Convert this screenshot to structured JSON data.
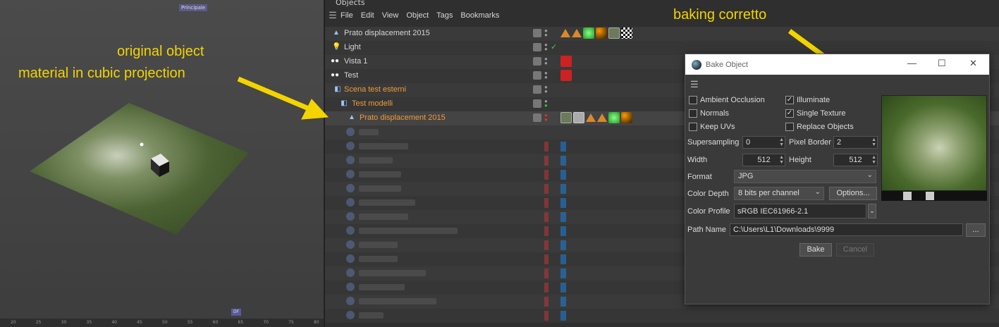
{
  "viewport": {
    "camera_label": "Principale",
    "ruler_ticks": [
      "20",
      "25",
      "30",
      "35",
      "40",
      "45",
      "50",
      "55",
      "60",
      "65",
      "70",
      "75",
      "80"
    ],
    "bottom_badge": "DF"
  },
  "annotations": {
    "left_line1": "original object",
    "left_line2": "material in cubic projection",
    "right": "baking corretto",
    "color": "#f2d400"
  },
  "objects_panel": {
    "title": "Objects",
    "menu": [
      "File",
      "Edit",
      "View",
      "Object",
      "Tags",
      "Bookmarks"
    ],
    "rows": [
      {
        "name": "Prato displacement 2015",
        "icon": "polygon-icon",
        "orange": false
      },
      {
        "name": "Light",
        "icon": "light-icon",
        "orange": false
      },
      {
        "name": "Vista 1",
        "icon": "camera-icon",
        "orange": false
      },
      {
        "name": "Test",
        "icon": "camera-icon",
        "orange": false
      },
      {
        "name": "Scena test esterni",
        "icon": "null-icon",
        "orange": true
      },
      {
        "name": "Test modelli",
        "icon": "null-icon",
        "orange": true
      },
      {
        "name": "Prato displacement 2015",
        "icon": "polygon-icon",
        "orange": true
      }
    ]
  },
  "dialog": {
    "title": "Bake Object",
    "options": {
      "ambient_occlusion": {
        "label": "Ambient Occlusion",
        "checked": false
      },
      "illuminate": {
        "label": "Illuminate",
        "checked": true
      },
      "normals": {
        "label": "Normals",
        "checked": false
      },
      "single_texture": {
        "label": "Single Texture",
        "checked": true
      },
      "keep_uvs": {
        "label": "Keep UVs",
        "checked": false
      },
      "replace_objects": {
        "label": "Replace Objects",
        "checked": false
      }
    },
    "supersampling": {
      "label": "Supersampling",
      "value": "0"
    },
    "pixel_border": {
      "label": "Pixel Border",
      "value": "2"
    },
    "width": {
      "label": "Width",
      "value": "512"
    },
    "height": {
      "label": "Height",
      "value": "512"
    },
    "format": {
      "label": "Format",
      "value": "JPG"
    },
    "color_depth": {
      "label": "Color Depth",
      "value": "8 bits per channel"
    },
    "options_button": "Options...",
    "color_profile": {
      "label": "Color Profile",
      "value": "sRGB IEC61966-2.1"
    },
    "path_name": {
      "label": "Path Name",
      "value": "C:\\Users\\L1\\Downloads\\9999"
    },
    "browse_button": "...",
    "bake_button": "Bake",
    "cancel_button": "Cancel"
  }
}
